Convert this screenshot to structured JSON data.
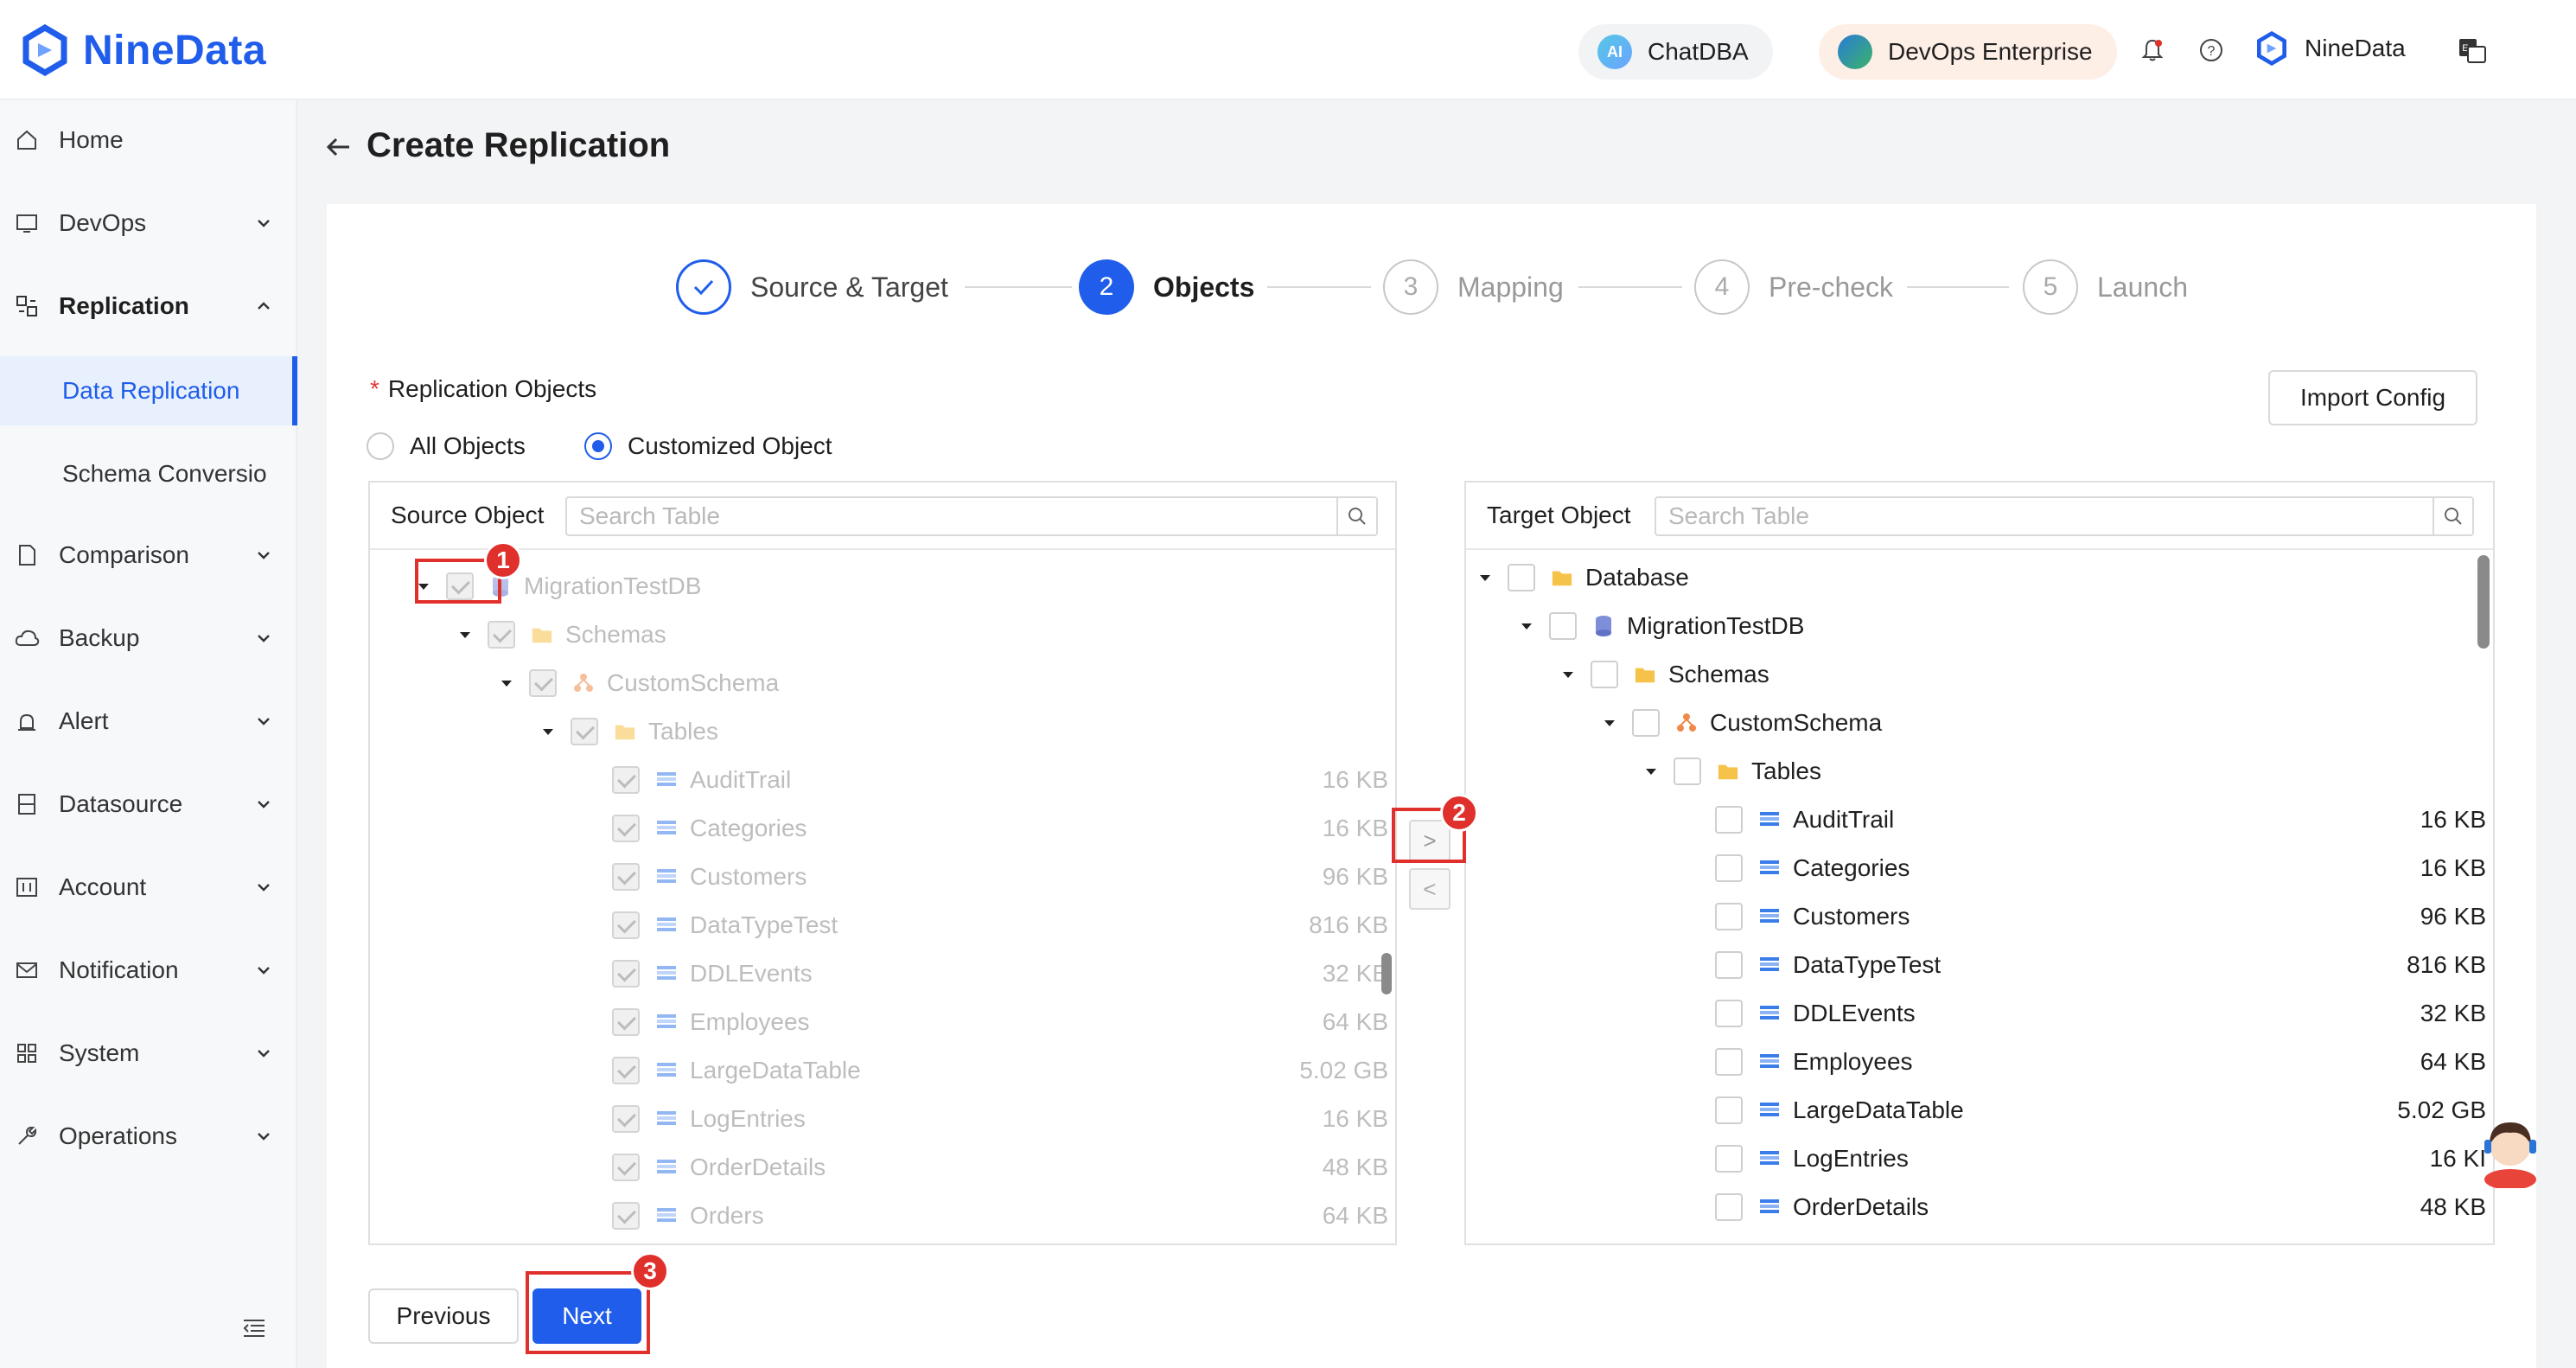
{
  "header": {
    "app_name": "NineData",
    "chatdba_label": "ChatDBA",
    "chatdba_icon_text": "AI",
    "edition_label": "DevOps Enterprise",
    "org_name": "NineData",
    "icons": [
      "bell-icon",
      "help-icon",
      "translate-icon"
    ]
  },
  "sidebar": {
    "items": [
      {
        "label": "Home",
        "icon": "home-icon"
      },
      {
        "label": "DevOps",
        "icon": "sql-icon"
      },
      {
        "label": "Replication",
        "icon": "replication-icon"
      },
      {
        "label": "Data Replication"
      },
      {
        "label": "Schema Conversio"
      },
      {
        "label": "Comparison",
        "icon": "document-icon"
      },
      {
        "label": "Backup",
        "icon": "cloud-icon"
      },
      {
        "label": "Alert",
        "icon": "alarm-icon"
      },
      {
        "label": "Datasource",
        "icon": "server-icon"
      },
      {
        "label": "Account",
        "icon": "account-icon"
      },
      {
        "label": "Notification",
        "icon": "mail-icon"
      },
      {
        "label": "System",
        "icon": "grid-icon"
      },
      {
        "label": "Operations",
        "icon": "wrench-icon"
      }
    ]
  },
  "page": {
    "title": "Create Replication"
  },
  "steps": [
    {
      "num": "",
      "label": "Source & Target",
      "state": "done"
    },
    {
      "num": "2",
      "label": "Objects",
      "state": "current"
    },
    {
      "num": "3",
      "label": "Mapping",
      "state": "todo"
    },
    {
      "num": "4",
      "label": "Pre-check",
      "state": "todo"
    },
    {
      "num": "5",
      "label": "Launch",
      "state": "todo"
    }
  ],
  "form": {
    "required_label": "Replication Objects",
    "import_config_label": "Import Config",
    "radio_all": "All Objects",
    "radio_custom": "Customized Object",
    "selected": "Customized Object"
  },
  "source": {
    "title": "Source Object",
    "search_placeholder": "Search Table",
    "database": "MigrationTestDB",
    "schemas": "Schemas",
    "schema": "CustomSchema",
    "tables_folder": "Tables",
    "tables": [
      {
        "name": "AuditTrail",
        "size": "16 KB"
      },
      {
        "name": "Categories",
        "size": "16 KB"
      },
      {
        "name": "Customers",
        "size": "96 KB"
      },
      {
        "name": "DataTypeTest",
        "size": "816 KB"
      },
      {
        "name": "DDLEvents",
        "size": "32 KB"
      },
      {
        "name": "Employees",
        "size": "64 KB"
      },
      {
        "name": "LargeDataTable",
        "size": "5.02 GB"
      },
      {
        "name": "LogEntries",
        "size": "16 KB"
      },
      {
        "name": "OrderDetails",
        "size": "48 KB"
      },
      {
        "name": "Orders",
        "size": "64 KB"
      }
    ]
  },
  "target": {
    "title": "Target Object",
    "search_placeholder": "Search Table",
    "root": "Database",
    "database": "MigrationTestDB",
    "schemas": "Schemas",
    "schema": "CustomSchema",
    "tables_folder": "Tables",
    "tables": [
      {
        "name": "AuditTrail",
        "size": "16 KB"
      },
      {
        "name": "Categories",
        "size": "16 KB"
      },
      {
        "name": "Customers",
        "size": "96 KB"
      },
      {
        "name": "DataTypeTest",
        "size": "816 KB"
      },
      {
        "name": "DDLEvents",
        "size": "32 KB"
      },
      {
        "name": "Employees",
        "size": "64 KB"
      },
      {
        "name": "LargeDataTable",
        "size": "5.02 GB"
      },
      {
        "name": "LogEntries",
        "size": "16 KI"
      },
      {
        "name": "OrderDetails",
        "size": "48 KB"
      }
    ]
  },
  "transfer": {
    "right": ">",
    "left": "<"
  },
  "footer": {
    "previous_label": "Previous",
    "next_label": "Next"
  },
  "annotations": [
    "1",
    "2",
    "3"
  ],
  "colors": {
    "brand": "#1f5dea",
    "annotation_red": "#e0302c"
  }
}
